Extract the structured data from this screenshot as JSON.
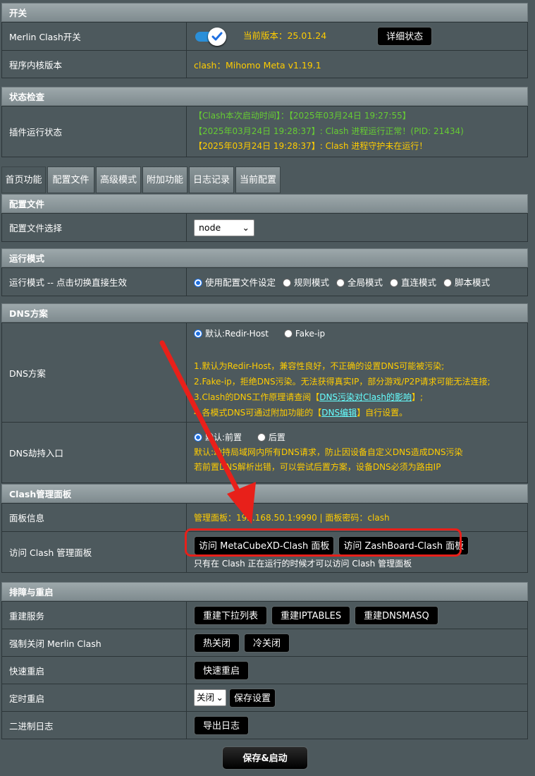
{
  "switch_section": {
    "title": "开关",
    "toggle_label": "Merlin Clash开关",
    "version_label": "当前版本：25.01.24",
    "detail_button": "详细状态",
    "core_label": "程序内核版本",
    "core_value": "clash：Mihomo Meta v1.19.1"
  },
  "status_section": {
    "title": "状态检查",
    "label": "插件运行状态",
    "line1": "【Clash本次启动时间】：【2025年03月24日 19:27:55】",
    "line2": "【2025年03月24日 19:28:37】: Clash 进程运行正常！(PID: 21434)",
    "line3": "【2025年03月24日 19:28:37】: Clash 进程守护未在运行！"
  },
  "tabs": [
    "首页功能",
    "配置文件",
    "高级模式",
    "附加功能",
    "日志记录",
    "当前配置"
  ],
  "config_section": {
    "title": "配置文件",
    "label": "配置文件选择",
    "selected": "node"
  },
  "mode_section": {
    "title": "运行模式",
    "label": "运行模式 -- 点击切换直接生效",
    "options": [
      "使用配置文件设定",
      "规则模式",
      "全局模式",
      "直连模式",
      "脚本模式"
    ]
  },
  "dns_section": {
    "title": "DNS方案",
    "label": "DNS方案",
    "opt_default": "默认:Redir-Host",
    "opt_fakeip": "Fake-ip",
    "note1": "1.默认为Redir-Host，兼容性良好，不正确的设置DNS可能被污染;",
    "note2": "2.Fake-ip，拒绝DNS污染。无法获得真实IP，部分游戏/P2P请求可能无法连接;",
    "note3_pre": "3.Clash的DNS工作原理请查阅【",
    "note3_link": "DNS污染对Clash的影响",
    "note3_post": "】;",
    "note4_pre": "4.各模式DNS可通过附加功能的【",
    "note4_link": "DNS编辑",
    "note4_post": "】自行设置。",
    "hijack_label": "DNS劫持入口",
    "hijack_default": "默认:前置",
    "hijack_back": "后置",
    "hijack_note1": "默认:劫持局域网内所有DNS请求，防止因设备自定义DNS造成DNS污染",
    "hijack_note2": "若前置DNS解析出错，可以尝试后置方案，设备DNS必须为路由IP"
  },
  "dashboard_section": {
    "title": "Clash管理面板",
    "info_label": "面板信息",
    "info_value": "管理面板：192.168.50.1:9990 | 面板密码：clash",
    "access_label": "访问 Clash 管理面板",
    "btn_metacube": "访问 MetaCubeXD-Clash 面板",
    "btn_zash": "访问 ZashBoard-Clash 面板",
    "access_note": "只有在 Clash 正在运行的时候才可以访问 Clash 管理面板"
  },
  "troubleshoot_section": {
    "title": "排障与重启",
    "rebuild_label": "重建服务",
    "btn_rebuild_list": "重建下拉列表",
    "btn_rebuild_iptables": "重建IPTABLES",
    "btn_rebuild_dnsmasq": "重建DNSMASQ",
    "force_close_label": "强制关闭 Merlin Clash",
    "btn_hot_close": "热关闭",
    "btn_cold_close": "冷关闭",
    "quick_restart_label": "快速重启",
    "btn_quick_restart": "快速重启",
    "timed_restart_label": "定时重启",
    "timed_select": "关闭",
    "btn_save_settings": "保存设置",
    "binary_log_label": "二进制日志",
    "btn_export_log": "导出日志"
  },
  "save_button": "保存&启动",
  "colors": {
    "background": "#4d595d",
    "header": "#8a9598",
    "yellow_text": "#ffcc00",
    "green_text": "#66cc33",
    "link": "#66ffff",
    "annotation_red": "#e8201a",
    "toggle_blue": "#2a8fd8"
  }
}
